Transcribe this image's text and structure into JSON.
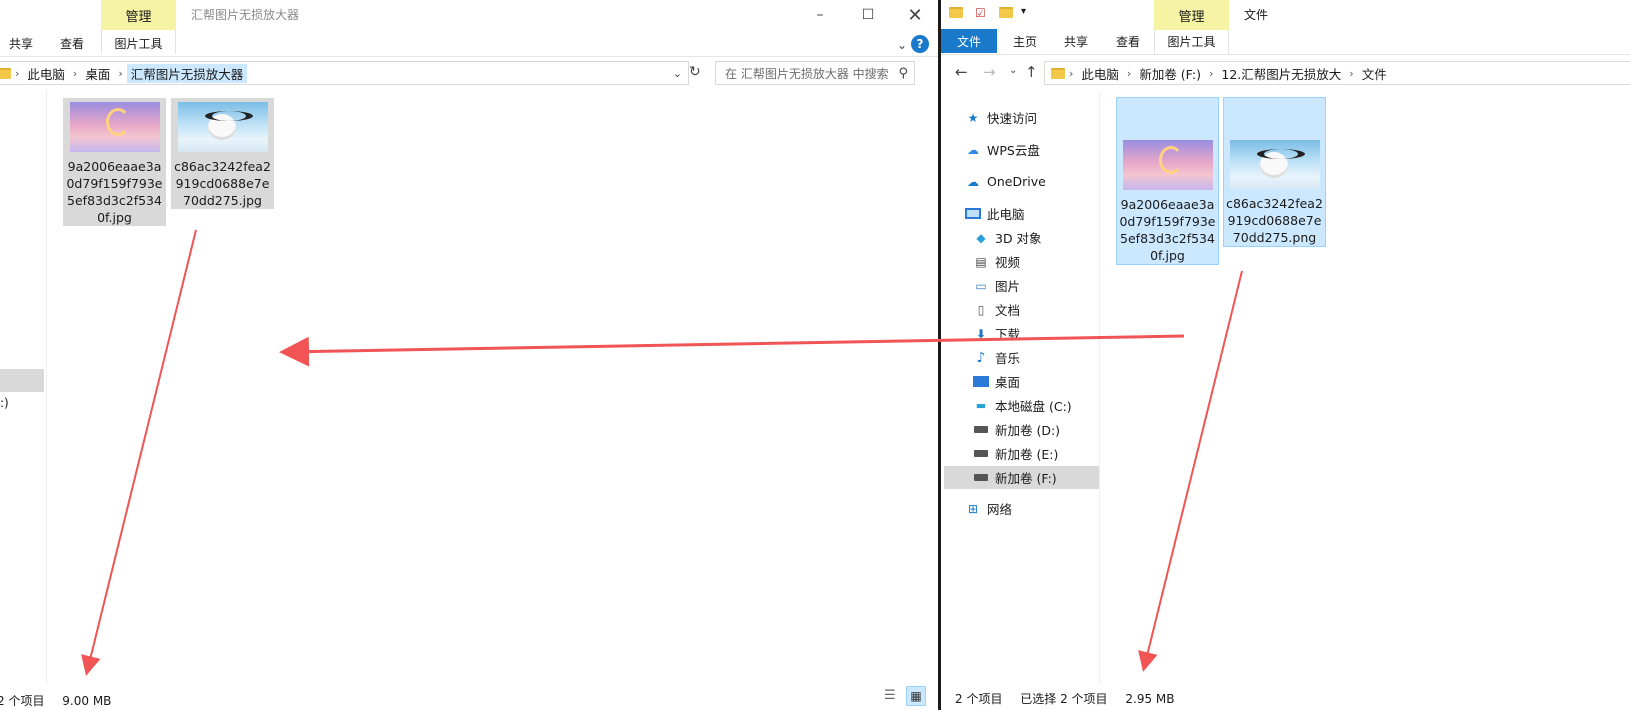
{
  "left": {
    "manage_tab": "管理",
    "window_title": "汇帮图片无损放大器",
    "tabs": [
      "共享",
      "查看"
    ],
    "picture_tools": "图片工具",
    "breadcrumb": [
      "此电脑",
      "桌面",
      "汇帮图片无损放大器"
    ],
    "search_placeholder": "在 汇帮图片无损放大器 中搜索",
    "side_fragment": ":)",
    "files": [
      {
        "name": "9a2006eaae3a0d79f159f793e5ef83d3c2f5340f.jpg"
      },
      {
        "name": "c86ac3242fea2919cd0688e7e70dd275.jpg"
      }
    ],
    "status": {
      "count": "2 个项目",
      "size": "9.00 MB"
    }
  },
  "right": {
    "manage_tab": "管理",
    "file_tab_top": "文件",
    "tabs": [
      "文件",
      "主页",
      "共享",
      "查看"
    ],
    "picture_tools": "图片工具",
    "breadcrumb": [
      "此电脑",
      "新加卷 (F:)",
      "12.汇帮图片无损放大",
      "文件"
    ],
    "nav": [
      {
        "label": "快速访问",
        "icon": "star-icon"
      },
      {
        "label": "WPS云盘",
        "icon": "cloud-icon"
      },
      {
        "label": "OneDrive",
        "icon": "onedrive-icon"
      },
      {
        "label": "此电脑",
        "icon": "computer-icon"
      },
      {
        "label": "3D 对象",
        "icon": "cube-icon"
      },
      {
        "label": "视频",
        "icon": "video-icon"
      },
      {
        "label": "图片",
        "icon": "picture-icon"
      },
      {
        "label": "文档",
        "icon": "document-icon"
      },
      {
        "label": "下载",
        "icon": "download-icon"
      },
      {
        "label": "音乐",
        "icon": "music-icon"
      },
      {
        "label": "桌面",
        "icon": "desktop-icon"
      },
      {
        "label": "本地磁盘 (C:)",
        "icon": "drive-icon"
      },
      {
        "label": "新加卷 (D:)",
        "icon": "drive-icon"
      },
      {
        "label": "新加卷 (E:)",
        "icon": "drive-icon"
      },
      {
        "label": "新加卷 (F:)",
        "icon": "drive-icon"
      },
      {
        "label": "网络",
        "icon": "network-icon"
      }
    ],
    "files": [
      {
        "name": "9a2006eaae3a0d79f159f793e5ef83d3c2f5340f.jpg"
      },
      {
        "name": "c86ac3242fea2919cd0688e7e70dd275.png"
      }
    ],
    "status": {
      "count": "2 个项目",
      "selected": "已选择 2 个项目",
      "size": "2.95 MB"
    }
  },
  "colors": {
    "accent": "#1979ca",
    "manage_bg": "#f7f3a4",
    "arrow": "#f05454",
    "selection": "#cce8ff"
  }
}
